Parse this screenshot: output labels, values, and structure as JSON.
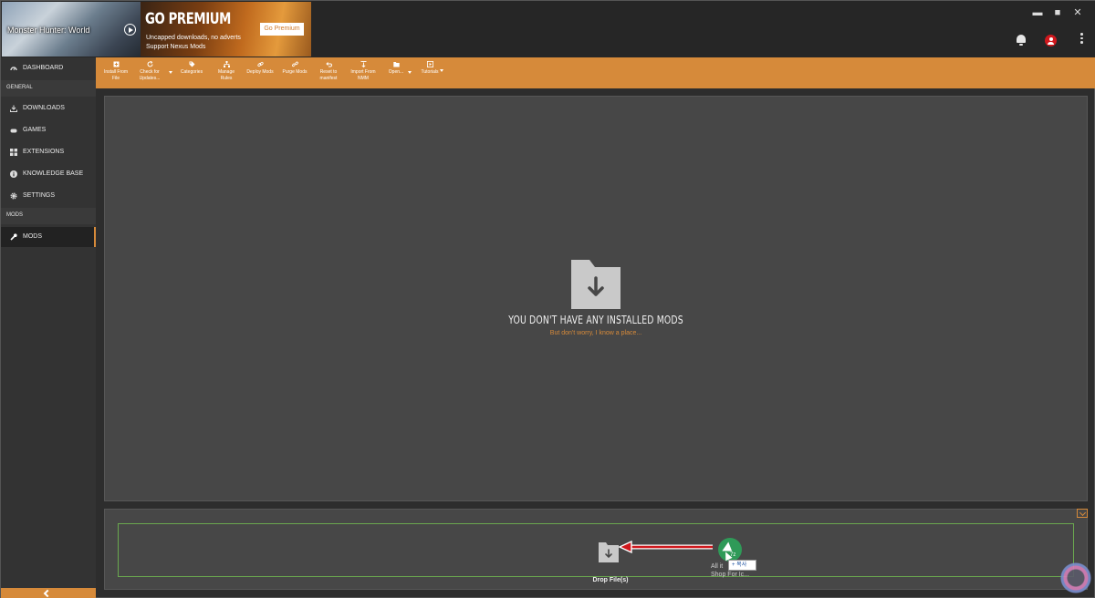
{
  "header": {
    "game_title": "Monster Hunter: World",
    "premium": {
      "headline": "GO PREMIUM",
      "line1": "Uncapped downloads, no adverts",
      "line2": "Support Nexus Mods",
      "button": "Go Premium"
    },
    "window_controls": {
      "minimize": "▬",
      "maximize": "■",
      "close": "✕"
    }
  },
  "sidebar": {
    "dashboard": "DASHBOARD",
    "section_general": "GENERAL",
    "downloads": "DOWNLOADS",
    "games": "GAMES",
    "extensions": "EXTENSIONS",
    "knowledge_base": "KNOWLEDGE BASE",
    "settings": "SETTINGS",
    "section_mods": "MODS",
    "mods": "MODS",
    "accent_color": "#d68a3a"
  },
  "toolbar": {
    "install_from_file": [
      "Install From",
      "File"
    ],
    "check_for_updates": [
      "Check for",
      "Updates..."
    ],
    "categories": "Categories",
    "manage_rules": [
      "Manage",
      "Rules"
    ],
    "deploy_mods": "Deploy Mods",
    "purge_mods": "Purge Mods",
    "reset_to_manifest": [
      "Reset to",
      "manifest"
    ],
    "import_from_nmm": [
      "Import From",
      "NMM"
    ],
    "open": "Open...",
    "tutorials": "Tutorials"
  },
  "main": {
    "empty_title": "YOU DON'T HAVE ANY INSTALLED MODS",
    "empty_link": "But don't worry, I know a place..."
  },
  "dropzone": {
    "label": "Drop File(s)"
  },
  "drag_overlay": {
    "file_ext": "7z",
    "file_name_line1": "All it",
    "file_name_line2": "Shop For Ic...",
    "copy_label": "+ 복사"
  }
}
